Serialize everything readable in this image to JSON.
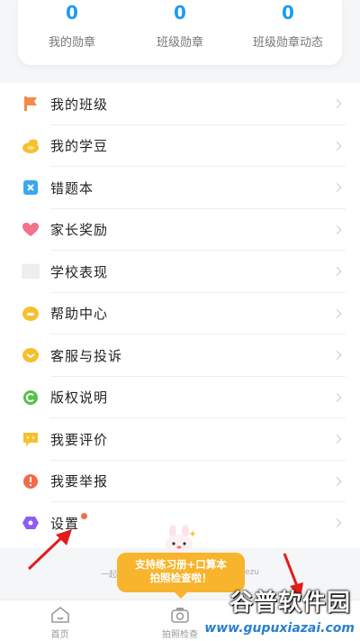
{
  "stats": [
    {
      "value": "0",
      "label": "我的勋章"
    },
    {
      "value": "0",
      "label": "班级勋章"
    },
    {
      "value": "0",
      "label": "班级勋章动态"
    }
  ],
  "menu": [
    {
      "label": "我的班级",
      "icon": "flag-icon",
      "color": "#f28b4a"
    },
    {
      "label": "我的学豆",
      "icon": "coins-icon",
      "color": "#f6c02d"
    },
    {
      "label": "错题本",
      "icon": "notebook-icon",
      "color": "#3aa8f0"
    },
    {
      "label": "家长奖励",
      "icon": "heart-icon",
      "color": "#f2728c"
    },
    {
      "label": "学校表现",
      "icon": "blank-icon",
      "color": "#eeeeee"
    },
    {
      "label": "帮助中心",
      "icon": "help-icon",
      "color": "#f6c02d"
    },
    {
      "label": "客服与投诉",
      "icon": "service-icon",
      "color": "#f6c02d"
    },
    {
      "label": "版权说明",
      "icon": "copyright-icon",
      "color": "#52c24a"
    },
    {
      "label": "我要评价",
      "icon": "comment-icon",
      "color": "#f6c02d"
    },
    {
      "label": "我要举报",
      "icon": "report-icon",
      "color": "#f26b4d"
    },
    {
      "label": "设置",
      "icon": "settings-icon",
      "color": "#8b5cf6"
    }
  ],
  "footer": {
    "left": "一起",
    "right": "ezu"
  },
  "promo": {
    "line1": "支持练习册+口算本",
    "line2": "拍照检查啦！"
  },
  "tabs": [
    {
      "label": "首页",
      "icon": "home-icon"
    },
    {
      "label": "拍照检查",
      "icon": "camera-icon"
    },
    {
      "label": "",
      "icon": ""
    }
  ],
  "watermark": {
    "title": "谷普软件园",
    "url": "www.gupuxiazai.com"
  }
}
